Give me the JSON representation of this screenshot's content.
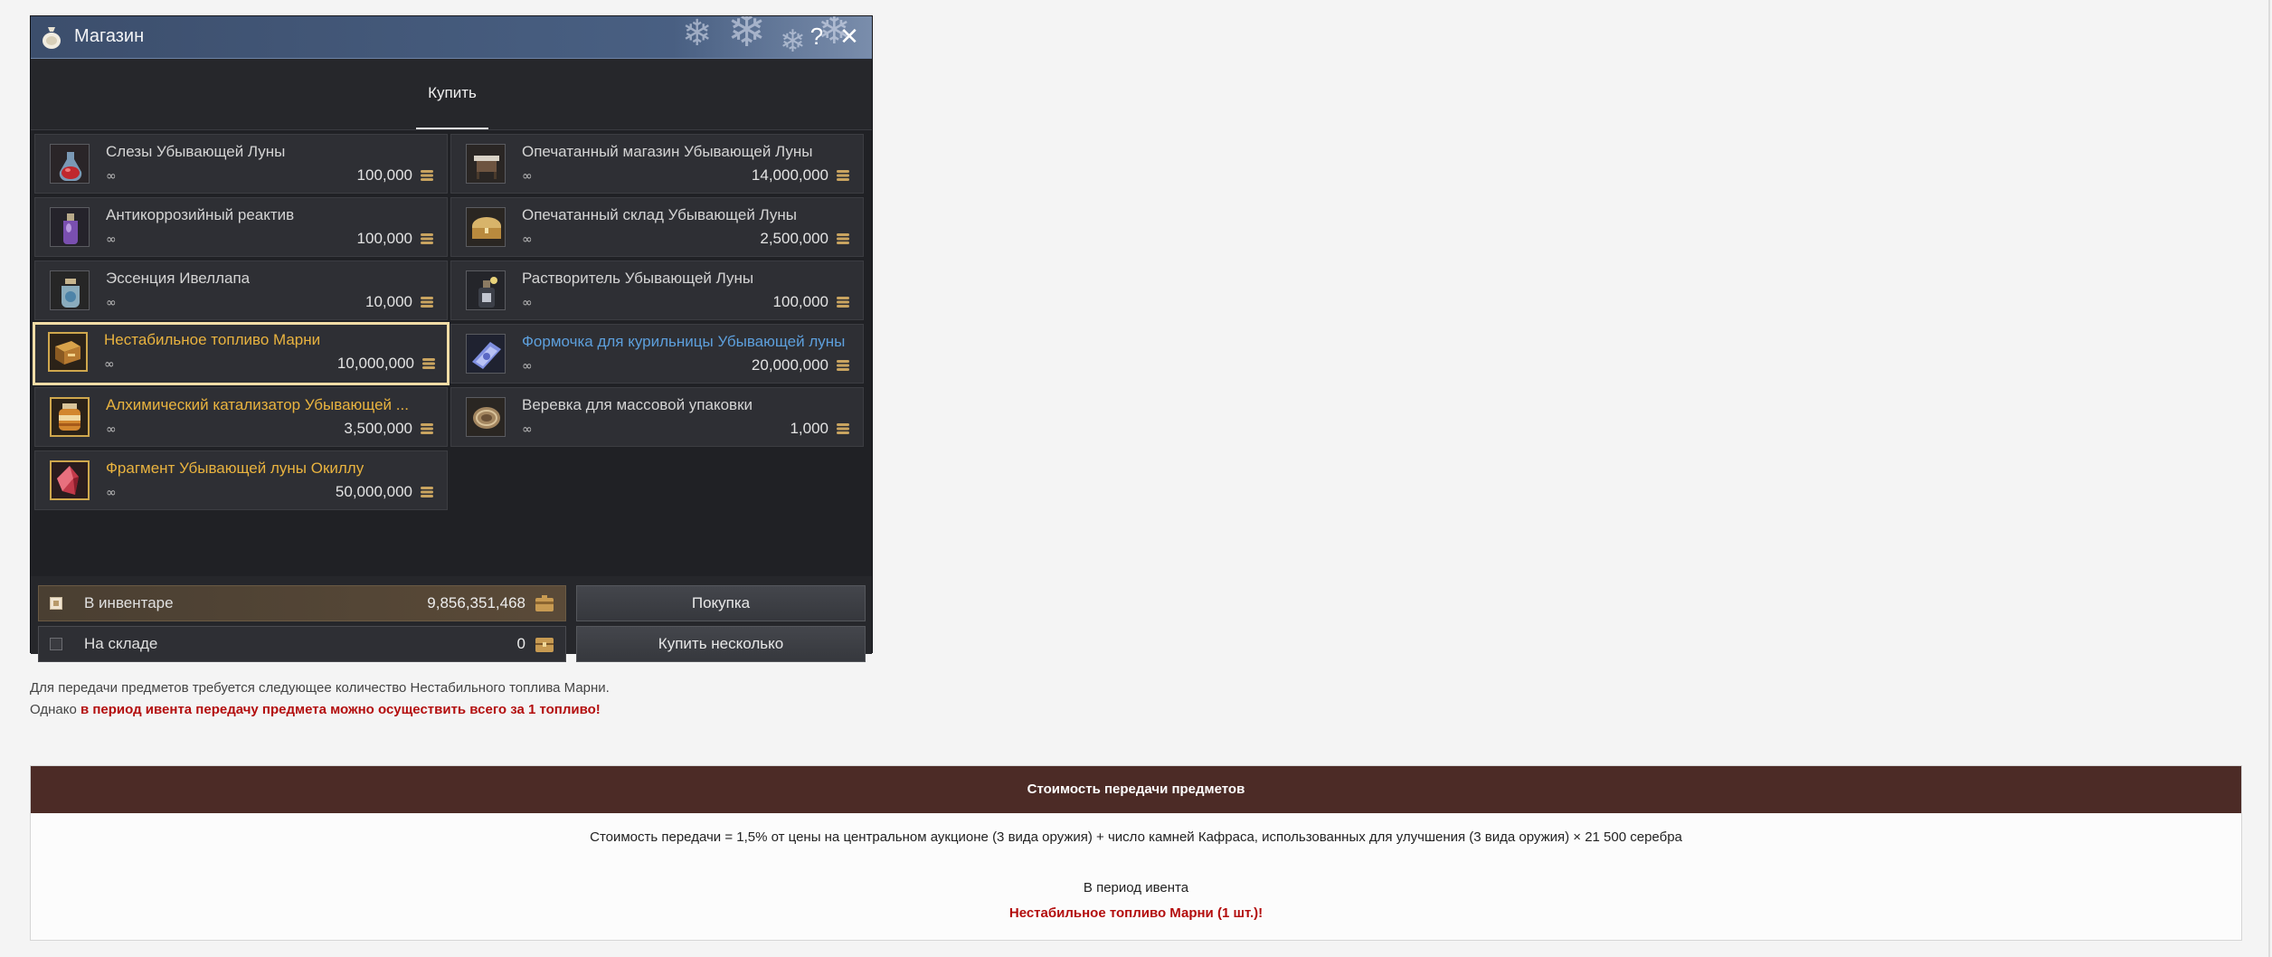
{
  "shop": {
    "title": "Магазин",
    "help_label": "?",
    "tab_buy": "Купить",
    "items": [
      {
        "name": "Слезы Убывающей Луны",
        "stock": "∞",
        "price": "100,000",
        "icon": "potion-icon",
        "name_color": "default"
      },
      {
        "name": "Опечатанный магазин Убывающей Луны",
        "stock": "∞",
        "price": "14,000,000",
        "icon": "shop-stall-icon",
        "name_color": "default"
      },
      {
        "name": "Антикоррозийный реактив",
        "stock": "∞",
        "price": "100,000",
        "icon": "reagent-bottle-icon",
        "name_color": "default"
      },
      {
        "name": "Опечатанный склад Убывающей Луны",
        "stock": "∞",
        "price": "2,500,000",
        "icon": "chest-icon",
        "name_color": "default"
      },
      {
        "name": "Эссенция Ивеллапа",
        "stock": "∞",
        "price": "10,000",
        "icon": "essence-jar-icon",
        "name_color": "default"
      },
      {
        "name": "Растворитель Убывающей Луны",
        "stock": "∞",
        "price": "100,000",
        "icon": "solvent-bottle-icon",
        "name_color": "default"
      },
      {
        "name": "Нестабильное топливо Марни",
        "stock": "∞",
        "price": "10,000,000",
        "icon": "fuel-box-icon",
        "name_color": "gold"
      },
      {
        "name": "Формочка для курильницы Убывающей луны",
        "stock": "∞",
        "price": "20,000,000",
        "icon": "mold-icon",
        "name_color": "blue"
      },
      {
        "name": "Алхимический катализатор Убывающей ...",
        "stock": "∞",
        "price": "3,500,000",
        "icon": "catalyst-jar-icon",
        "name_color": "gold"
      },
      {
        "name": "Веревка для массовой упаковки",
        "stock": "∞",
        "price": "1,000",
        "icon": "rope-icon",
        "name_color": "default"
      },
      {
        "name": "Фрагмент Убывающей луны Окиллу",
        "stock": "∞",
        "price": "50,000,000",
        "icon": "crystal-fragment-icon",
        "name_color": "gold"
      }
    ],
    "inventory_label": "В инвентаре",
    "inventory_value": "9,856,351,468",
    "storage_label": "На складе",
    "storage_value": "0",
    "purchase_button": "Покупка",
    "buy_multiple_button": "Купить несколько",
    "selected_item_index": 6
  },
  "notes": {
    "line1": "Для передачи предметов требуется следующее количество Нестабильного топлива Марни.",
    "line2_prefix": "Однако ",
    "line2_highlight": "в период ивента передачу предмета можно осуществить всего за 1 топливо!"
  },
  "cost_table": {
    "header": "Стоимость передачи предметов",
    "formula": "Стоимость передачи = 1,5% от цены на центральном аукционе (3 вида оружия) + число камней Кафраса, использованных для улучшения (3 вида оружия) × 21 500 серебра",
    "event_label": "В период ивента",
    "event_value": "Нестабильное топливо Марни (1 шт.)!"
  },
  "colors": {
    "title_bar": "#465c7e",
    "gold_text": "#e9b33f",
    "blue_text": "#5d9fdc",
    "highlight_red": "#b30d0d",
    "table_header": "#4c2b26"
  }
}
